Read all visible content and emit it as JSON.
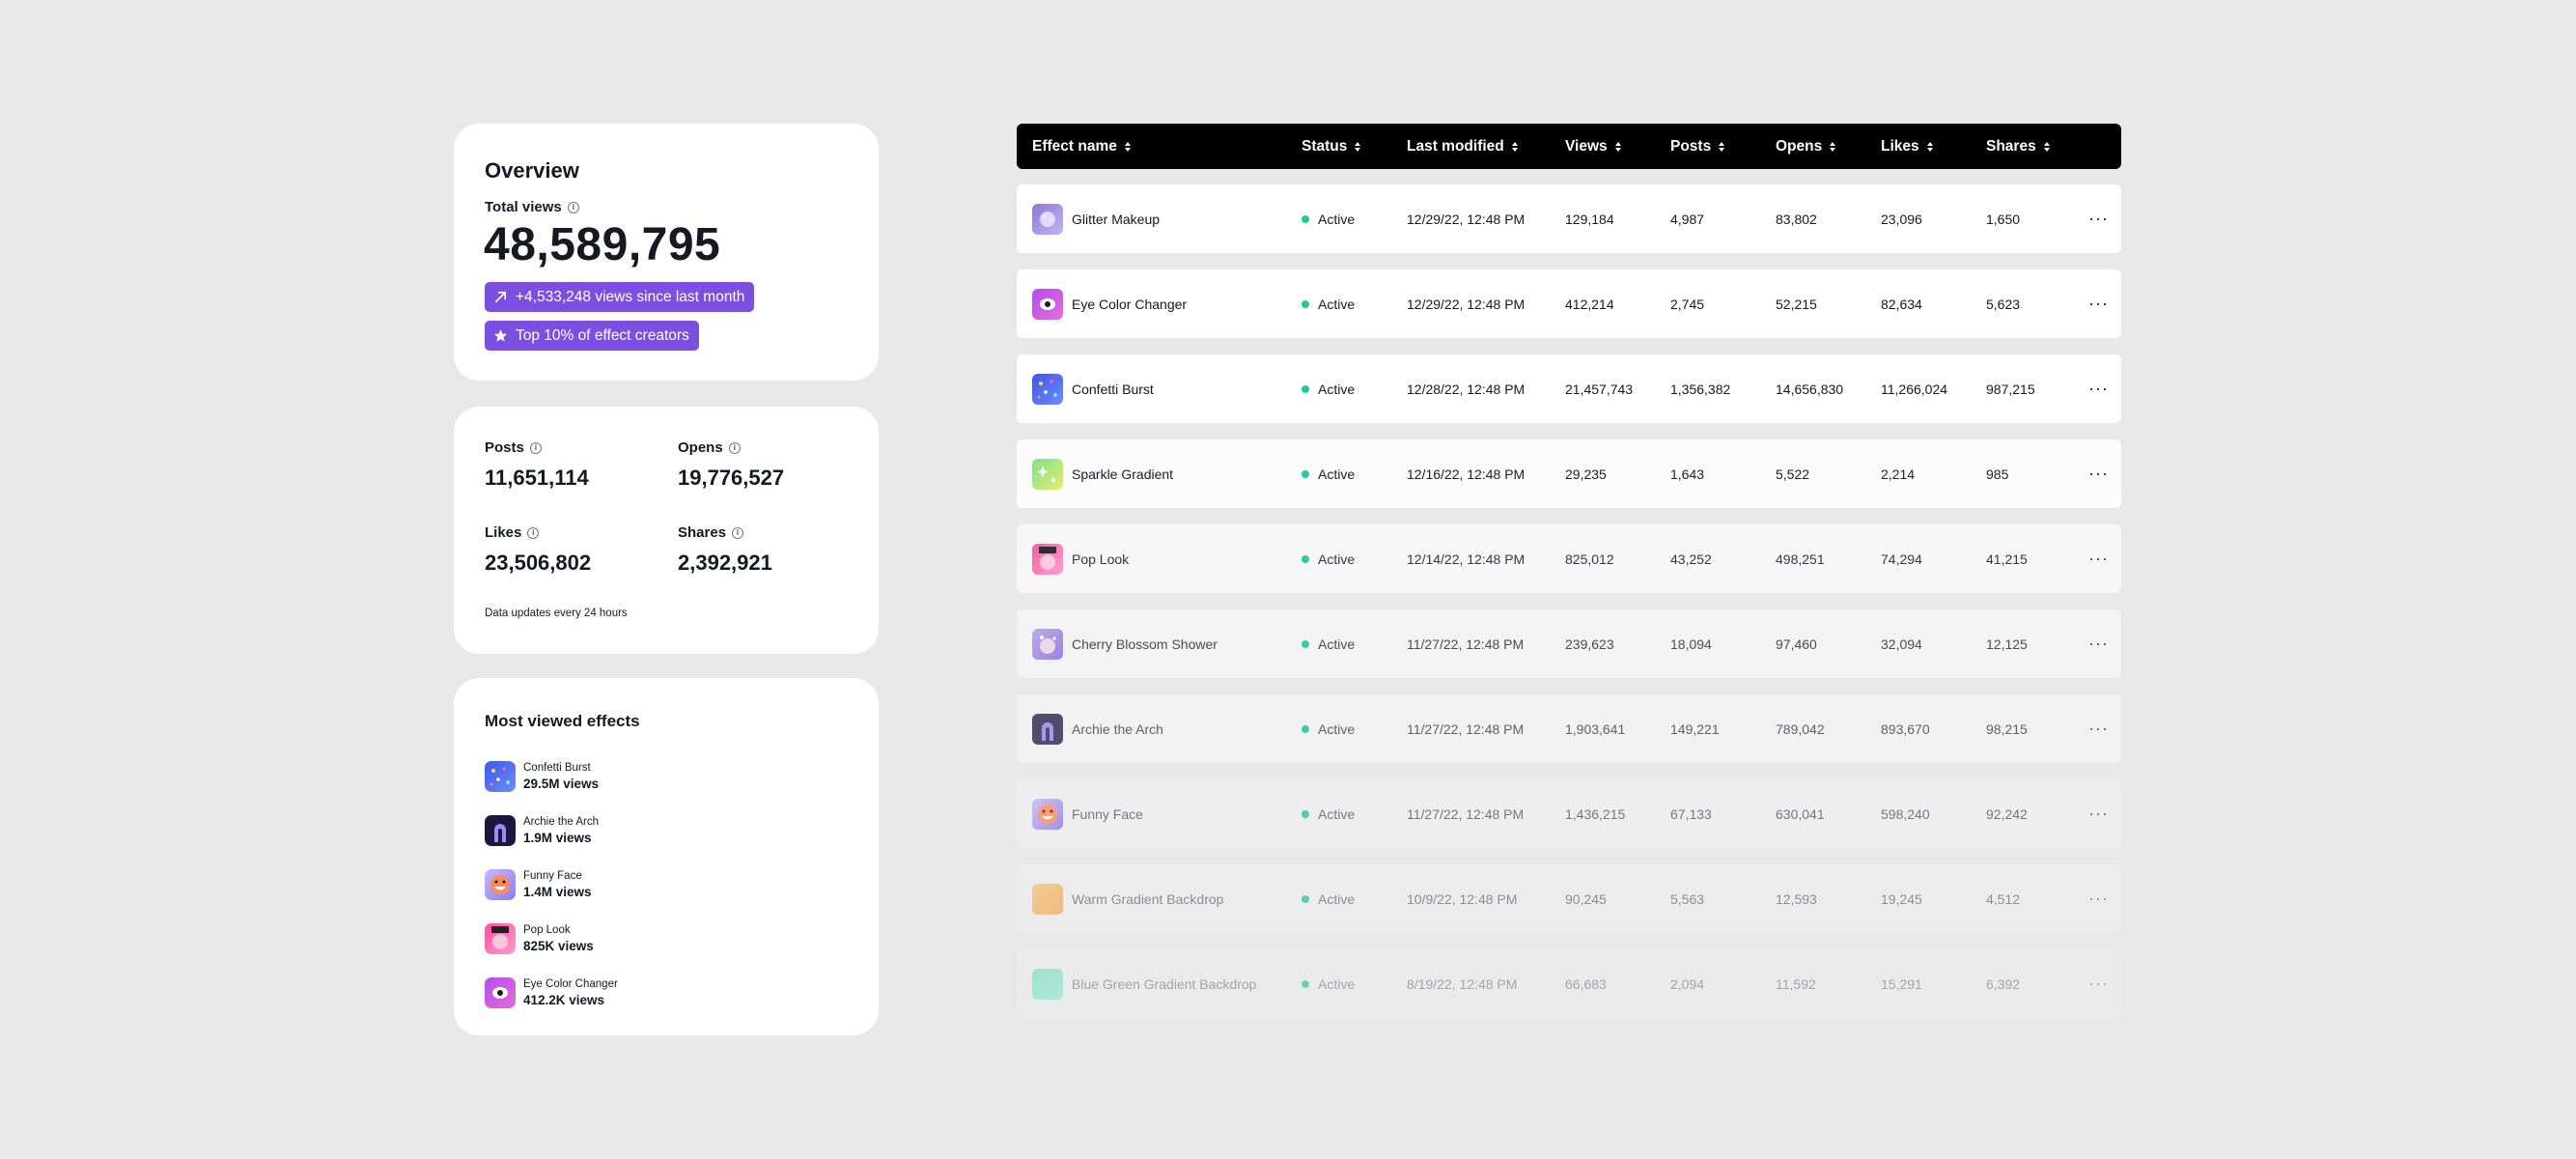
{
  "overview": {
    "title": "Overview",
    "total_views_label": "Total views",
    "total_views": "48,589,795",
    "growth_badge": "+4,533,248 views since last month",
    "rank_badge": "Top 10% of effect creators",
    "accent_color": "#7b4fe0"
  },
  "stats": {
    "posts_label": "Posts",
    "posts": "11,651,114",
    "opens_label": "Opens",
    "opens": "19,776,527",
    "likes_label": "Likes",
    "likes": "23,506,802",
    "shares_label": "Shares",
    "shares": "2,392,921",
    "note": "Data updates every 24 hours"
  },
  "most_viewed": {
    "title": "Most viewed effects",
    "items": [
      {
        "name": "Confetti Burst",
        "views": "29.5M views",
        "icon": "confetti-icon"
      },
      {
        "name": "Archie the Arch",
        "views": "1.9M views",
        "icon": "arch-icon"
      },
      {
        "name": "Funny Face",
        "views": "1.4M views",
        "icon": "funny-face-icon"
      },
      {
        "name": "Pop Look",
        "views": "825K views",
        "icon": "pop-look-icon"
      },
      {
        "name": "Eye Color Changer",
        "views": "412.2K views",
        "icon": "eye-icon"
      }
    ]
  },
  "table": {
    "columns": [
      "Effect name",
      "Status",
      "Last modified",
      "Views",
      "Posts",
      "Opens",
      "Likes",
      "Shares"
    ],
    "status_color": "#20c997",
    "rows": [
      {
        "name": "Glitter Makeup",
        "status": "Active",
        "modified": "12/29/22, 12:48 PM",
        "views": "129,184",
        "posts": "4,987",
        "opens": "83,802",
        "likes": "23,096",
        "shares": "1,650",
        "icon": "glitter-icon"
      },
      {
        "name": "Eye Color Changer",
        "status": "Active",
        "modified": "12/29/22, 12:48 PM",
        "views": "412,214",
        "posts": "2,745",
        "opens": "52,215",
        "likes": "82,634",
        "shares": "5,623",
        "icon": "eye-icon"
      },
      {
        "name": "Confetti Burst",
        "status": "Active",
        "modified": "12/28/22, 12:48 PM",
        "views": "21,457,743",
        "posts": "1,356,382",
        "opens": "14,656,830",
        "likes": "11,266,024",
        "shares": "987,215",
        "icon": "confetti-icon"
      },
      {
        "name": "Sparkle Gradient",
        "status": "Active",
        "modified": "12/16/22, 12:48 PM",
        "views": "29,235",
        "posts": "1,643",
        "opens": "5,522",
        "likes": "2,214",
        "shares": "985",
        "icon": "sparkle-icon"
      },
      {
        "name": "Pop Look",
        "status": "Active",
        "modified": "12/14/22, 12:48 PM",
        "views": "825,012",
        "posts": "43,252",
        "opens": "498,251",
        "likes": "74,294",
        "shares": "41,215",
        "icon": "pop-look-icon"
      },
      {
        "name": "Cherry Blossom Shower",
        "status": "Active",
        "modified": "11/27/22, 12:48 PM",
        "views": "239,623",
        "posts": "18,094",
        "opens": "97,460",
        "likes": "32,094",
        "shares": "12,125",
        "icon": "cherry-blossom-icon"
      },
      {
        "name": "Archie the Arch",
        "status": "Active",
        "modified": "11/27/22, 12:48 PM",
        "views": "1,903,641",
        "posts": "149,221",
        "opens": "789,042",
        "likes": "893,670",
        "shares": "98,215",
        "icon": "arch-icon"
      },
      {
        "name": "Funny Face",
        "status": "Active",
        "modified": "11/27/22, 12:48 PM",
        "views": "1,436,215",
        "posts": "67,133",
        "opens": "630,041",
        "likes": "598,240",
        "shares": "92,242",
        "icon": "funny-face-icon"
      },
      {
        "name": "Warm Gradient Backdrop",
        "status": "Active",
        "modified": "10/9/22, 12:48 PM",
        "views": "90,245",
        "posts": "5,563",
        "opens": "12,593",
        "likes": "19,245",
        "shares": "4,512",
        "icon": "warm-gradient-icon"
      },
      {
        "name": "Blue Green Gradient Backdrop",
        "status": "Active",
        "modified": "8/19/22, 12:48 PM",
        "views": "66,683",
        "posts": "2,094",
        "opens": "11,592",
        "likes": "15,291",
        "shares": "6,392",
        "icon": "blue-green-gradient-icon"
      }
    ]
  }
}
